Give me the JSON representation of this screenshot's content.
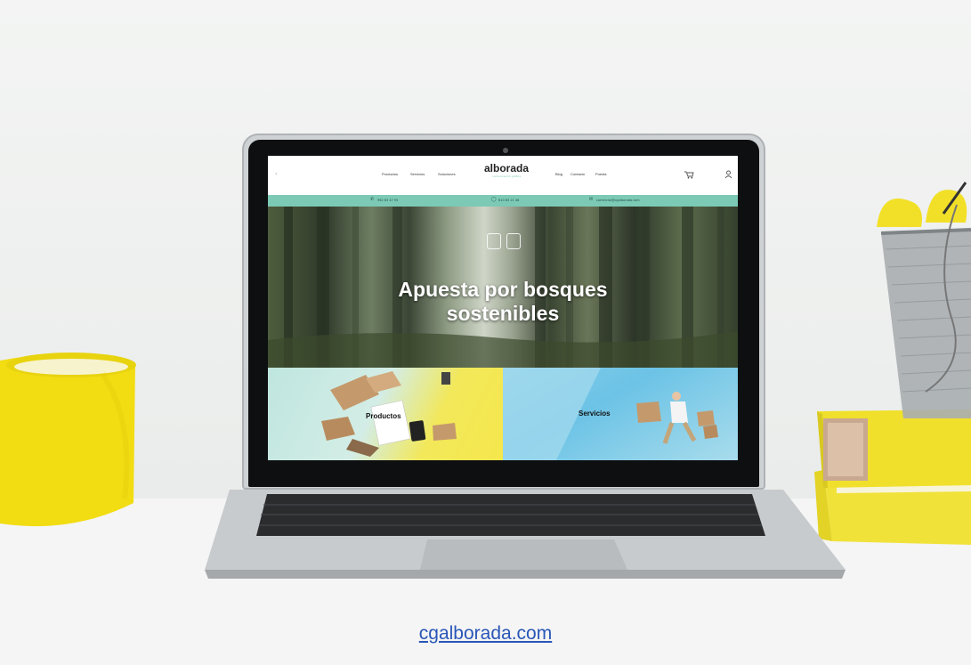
{
  "caption": {
    "url": "cgalborada.com"
  },
  "website": {
    "logo": "alborada",
    "logo_tagline": "comunicación gráfica",
    "nav_left": [
      "Productos",
      "Servicios",
      "Soluciones"
    ],
    "nav_right": [
      "Blog",
      "Contacto",
      "Puesta"
    ],
    "contact_bar": {
      "phone": "962 63 47 95",
      "whatsapp": "610 83 21 46",
      "email": "comercial@cgalborada.com"
    },
    "hero_title_line1": "Apuesta por bosques",
    "hero_title_line2": "sostenibles",
    "panels": {
      "products_label": "Productos",
      "services_label": "Servicios"
    }
  },
  "colors": {
    "accent_teal": "#7cc9b5",
    "mug_yellow": "#f7e21c",
    "books_yellow": "#f1e23a",
    "link_blue": "#2a56b8"
  },
  "icons": {
    "cart": "cart-icon",
    "user": "user-icon",
    "menu": "menu-icon",
    "phone": "phone-icon",
    "whatsapp": "whatsapp-icon",
    "mail": "mail-icon"
  }
}
